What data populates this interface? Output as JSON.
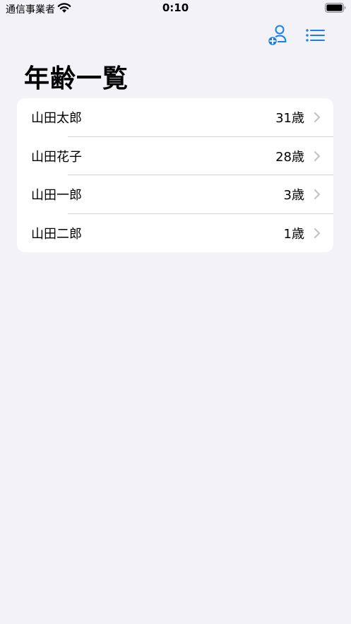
{
  "status_bar": {
    "carrier": "通信事業者",
    "time": "0:10"
  },
  "nav": {
    "add_person_icon": "person-badge-plus-icon",
    "list_icon": "list-bullet-icon",
    "accent_color": "#1a7fe8"
  },
  "title": "年齢一覧",
  "people": [
    {
      "name": "山田太郎",
      "age": "31歳"
    },
    {
      "name": "山田花子",
      "age": "28歳"
    },
    {
      "name": "山田一郎",
      "age": "3歳"
    },
    {
      "name": "山田二郎",
      "age": "1歳"
    }
  ]
}
